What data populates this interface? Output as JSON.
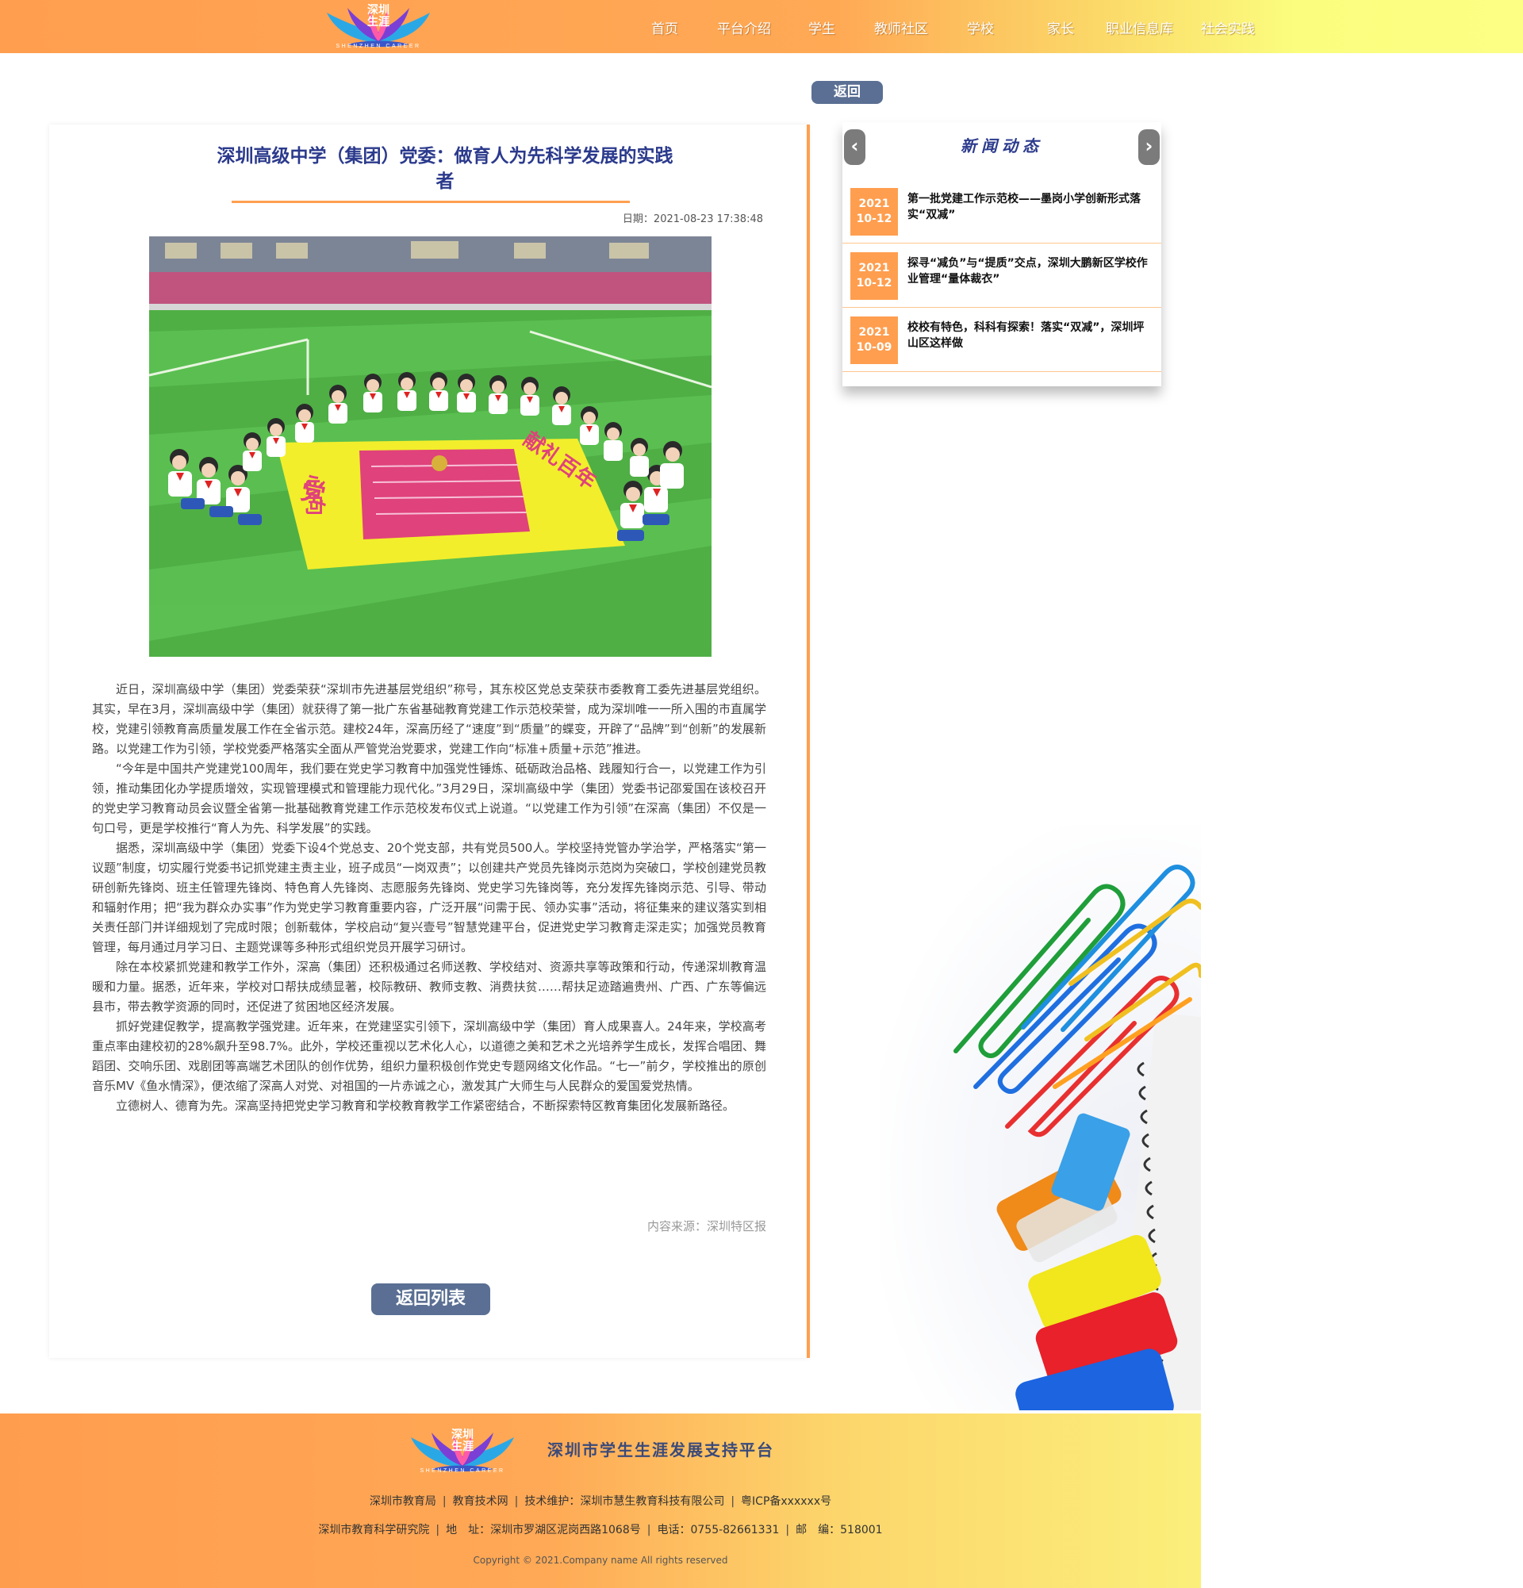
{
  "header": {
    "logo_text_line1": "深圳",
    "logo_text_line2": "生涯",
    "logo_sub": "SHENZHEN CAREER",
    "nav": [
      "首页",
      "平台介绍",
      "学生",
      "教师社区",
      "学校",
      "家长",
      "职业信息库",
      "社会实践"
    ]
  },
  "actions": {
    "back": "返回",
    "back_to_list": "返回列表"
  },
  "article": {
    "title": "深圳高级中学（集团）党委：做育人为先科学发展的实践者",
    "date": "日期：2021-08-23 17:38:48",
    "photo_texts": [
      "党",
      "心向",
      "献礼百年"
    ],
    "paragraphs": [
      "近日，深圳高级中学（集团）党委荣获“深圳市先进基层党组织”称号，其东校区党总支荣获市委教育工委先进基层党组织。其实，早在3月，深圳高级中学（集团）就获得了第一批广东省基础教育党建工作示范校荣誉，成为深圳唯一一所入围的市直属学校，党建引领教育高质量发展工作在全省示范。建校24年，深高历经了“速度”到“质量”的蝶变，开辟了“品牌”到“创新”的发展新路。以党建工作为引领，学校党委严格落实全面从严管党治党要求，党建工作向“标准+质量+示范”推进。",
      "“今年是中国共产党建党100周年，我们要在党史学习教育中加强党性锤炼、砥砺政治品格、践履知行合一，以党建工作为引领，推动集团化办学提质增效，实现管理模式和管理能力现代化。”3月29日，深圳高级中学（集团）党委书记邵爱国在该校召开的党史学习教育动员会议暨全省第一批基础教育党建工作示范校发布仪式上说道。“以党建工作为引领”在深高（集团）不仅是一句口号，更是学校推行“育人为先、科学发展”的实践。",
      "据悉，深圳高级中学（集团）党委下设4个党总支、20个党支部，共有党员500人。学校坚持党管办学治学，严格落实“第一议题”制度，切实履行党委书记抓党建主责主业，班子成员“一岗双责”；以创建共产党员先锋岗示范岗为突破口，学校创建党员教研创新先锋岗、班主任管理先锋岗、特色育人先锋岗、志愿服务先锋岗、党史学习先锋岗等，充分发挥先锋岗示范、引导、带动和辐射作用；把“我为群众办实事”作为党史学习教育重要内容，广泛开展“问需于民、领办实事”活动，将征集来的建议落实到相关责任部门并详细规划了完成时限；创新载体，学校启动“复兴壹号”智慧党建平台，促进党史学习教育走深走实；加强党员教育管理，每月通过月学习日、主题党课等多种形式组织党员开展学习研讨。",
      "除在本校紧抓党建和教学工作外，深高（集团）还积极通过名师送教、学校结对、资源共享等政策和行动，传递深圳教育温暖和力量。据悉，近年来，学校对口帮扶成绩显著，校际教研、教师支教、消费扶贫……帮扶足迹踏遍贵州、广西、广东等偏远县市，带去教学资源的同时，还促进了贫困地区经济发展。",
      "抓好党建促教学，提高教学强党建。近年来，在党建坚实引领下，深圳高级中学（集团）育人成果喜人。24年来，学校高考重点率由建校初的28%飙升至98.7%。此外，学校还重视以艺术化人心，以道德之美和艺术之光培养学生成长，发挥合唱团、舞蹈团、交响乐团、戏剧团等高端艺术团队的创作优势，组织力量积极创作党史专题网络文化作品。“七一”前夕，学校推出的原创音乐MV《鱼水情深》，便浓缩了深高人对党、对祖国的一片赤诚之心，激发其广大师生与人民群众的爱国爱党热情。",
      "立德树人、德育为先。深高坚持把党史学习教育和学校教育教学工作紧密结合，不断探索特区教育集团化发展新路径。"
    ],
    "source": "内容来源：深圳特区报"
  },
  "news": {
    "title": "新闻动态",
    "prev_icon": "‹",
    "next_icon": "›",
    "items": [
      {
        "year": "2021",
        "day": "10-12",
        "title": "第一批党建工作示范校——墨岗小学创新形式落实“双减”"
      },
      {
        "year": "2021",
        "day": "10-12",
        "title": "探寻“减负”与“提质”交点，深圳大鹏新区学校作业管理“量体裁衣”"
      },
      {
        "year": "2021",
        "day": "10-09",
        "title": "校校有特色，科科有探索！落实“双减”，深圳坪山区这样做"
      }
    ]
  },
  "footer": {
    "logo_text_line1": "深圳",
    "logo_text_line2": "生涯",
    "logo_sub": "SHENZHEN CAREER",
    "title": "深圳市学生生涯发展支持平台",
    "row1": [
      "深圳市教育局",
      "教育技术网",
      "技术维护：深圳市慧生教育科技有限公司",
      "粤ICP备xxxxxx号"
    ],
    "row2": [
      "深圳市教育科学研究院",
      "地　址：深圳市罗湖区泥岗西路1068号",
      "电话：0755-82661331",
      "邮　编：518001"
    ],
    "copyright": "Copyright © 2021.Company name All rights reserved"
  }
}
